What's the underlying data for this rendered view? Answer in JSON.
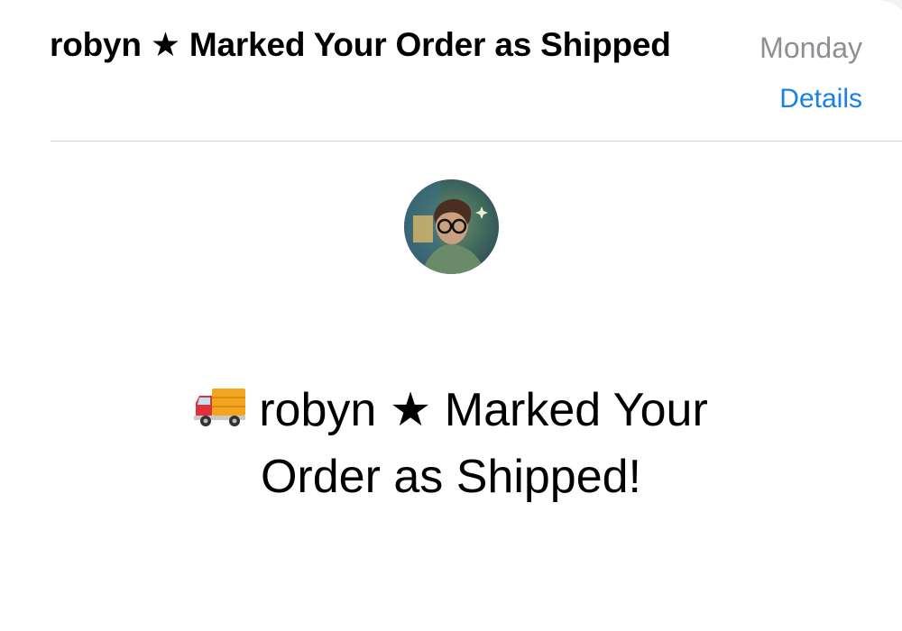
{
  "email": {
    "subject": "robyn ★ Marked Your Order as Shipped",
    "date": "Monday",
    "details_label": "Details",
    "sender_avatar": "avatar-portrait",
    "body": {
      "icon": "delivery-truck-icon",
      "heading_line1": "robyn ★ Marked Your",
      "heading_line2": "Order as Shipped!"
    }
  },
  "colors": {
    "link": "#1a7fe6",
    "secondary_text": "#8e8e93",
    "divider": "#d4d4d6"
  }
}
